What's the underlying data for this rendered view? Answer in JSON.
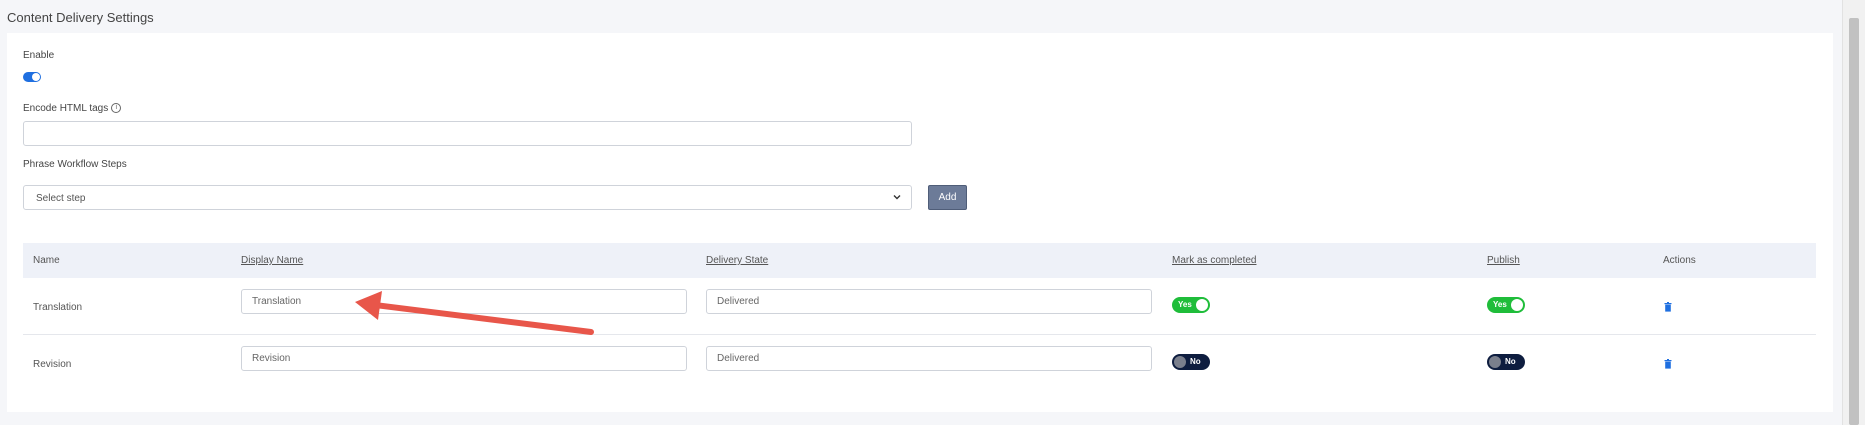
{
  "page": {
    "title": "Content Delivery Settings"
  },
  "enable": {
    "label": "Enable",
    "checked": true,
    "color": "#1f6fe0"
  },
  "encode": {
    "label": "Encode HTML tags",
    "info_icon": "info-icon",
    "value": ""
  },
  "workflow": {
    "label": "Phrase Workflow Steps",
    "select_value": "Select step",
    "add_label": "Add"
  },
  "table": {
    "headers": {
      "name": "Name",
      "display_name": "Display Name",
      "delivery_state": "Delivery State",
      "mark_completed": "Mark as completed",
      "publish": "Publish",
      "actions": "Actions"
    },
    "rows": [
      {
        "name": "Translation",
        "display_name": "Translation",
        "delivery_state": "Delivered",
        "mark_completed": "Yes",
        "publish": "Yes"
      },
      {
        "name": "Revision",
        "display_name": "Revision",
        "delivery_state": "Delivered",
        "mark_completed": "No",
        "publish": "No"
      }
    ]
  },
  "colors": {
    "toggle_yes": "#1fbd3a",
    "toggle_no": "#0e1d3f",
    "add_button": "#6c7b98",
    "trash": "#1f6fe0",
    "annotation_arrow": "#e8564a"
  }
}
